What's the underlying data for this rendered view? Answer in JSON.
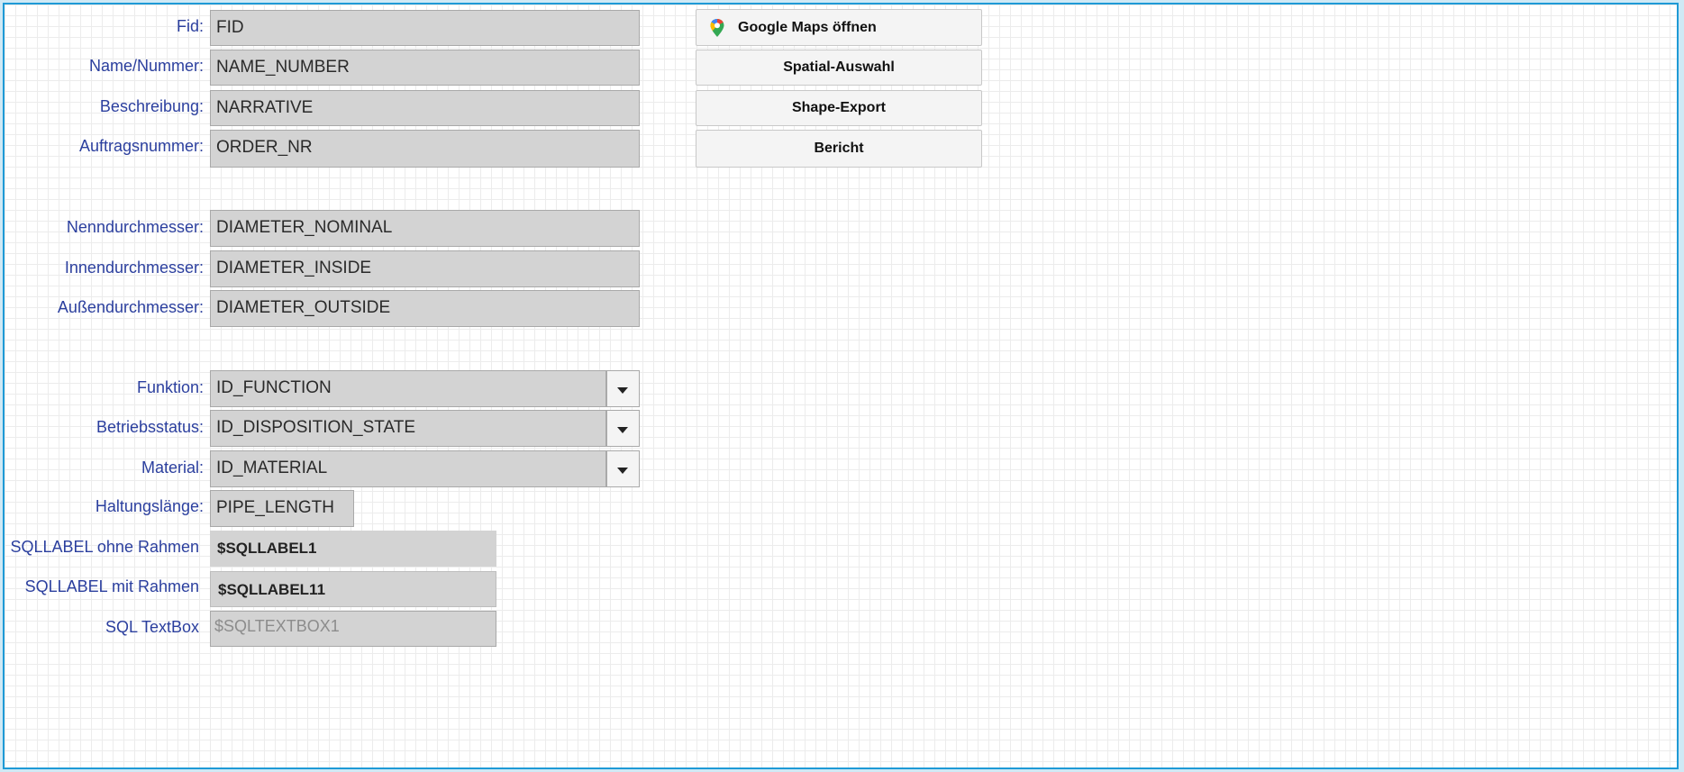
{
  "fields": {
    "fid": {
      "label": "Fid:",
      "value": "FID"
    },
    "name": {
      "label": "Name/Nummer:",
      "value": "NAME_NUMBER"
    },
    "description": {
      "label": "Beschreibung:",
      "value": "NARRATIVE"
    },
    "order": {
      "label": "Auftragsnummer:",
      "value": "ORDER_NR"
    },
    "diam_nominal": {
      "label": "Nenndurchmesser:",
      "value": "DIAMETER_NOMINAL"
    },
    "diam_inside": {
      "label": "Innendurchmesser:",
      "value": "DIAMETER_INSIDE"
    },
    "diam_outside": {
      "label": "Außendurchmesser:",
      "value": "DIAMETER_OUTSIDE"
    },
    "function": {
      "label": "Funktion:",
      "value": "ID_FUNCTION"
    },
    "state": {
      "label": "Betriebsstatus:",
      "value": "ID_DISPOSITION_STATE"
    },
    "material": {
      "label": "Material:",
      "value": "ID_MATERIAL"
    },
    "length": {
      "label": "Haltungslänge:",
      "value": "PIPE_LENGTH"
    }
  },
  "sql": {
    "label_no_border": {
      "label": "SQLLABEL ohne Rahmen",
      "value": "$SQLLABEL1"
    },
    "label_with_border": {
      "label": "SQLLABEL mit Rahmen",
      "value": "$SQLLABEL11"
    },
    "textbox": {
      "label": "SQL TextBox",
      "value": "$SQLTEXTBOX1"
    }
  },
  "buttons": {
    "maps": "Google Maps öffnen",
    "spatial": "Spatial-Auswahl",
    "shape": "Shape-Export",
    "report": "Bericht"
  },
  "icons": {
    "maps": "google-maps-pin-icon",
    "dropdown": "chevron-down-icon"
  }
}
